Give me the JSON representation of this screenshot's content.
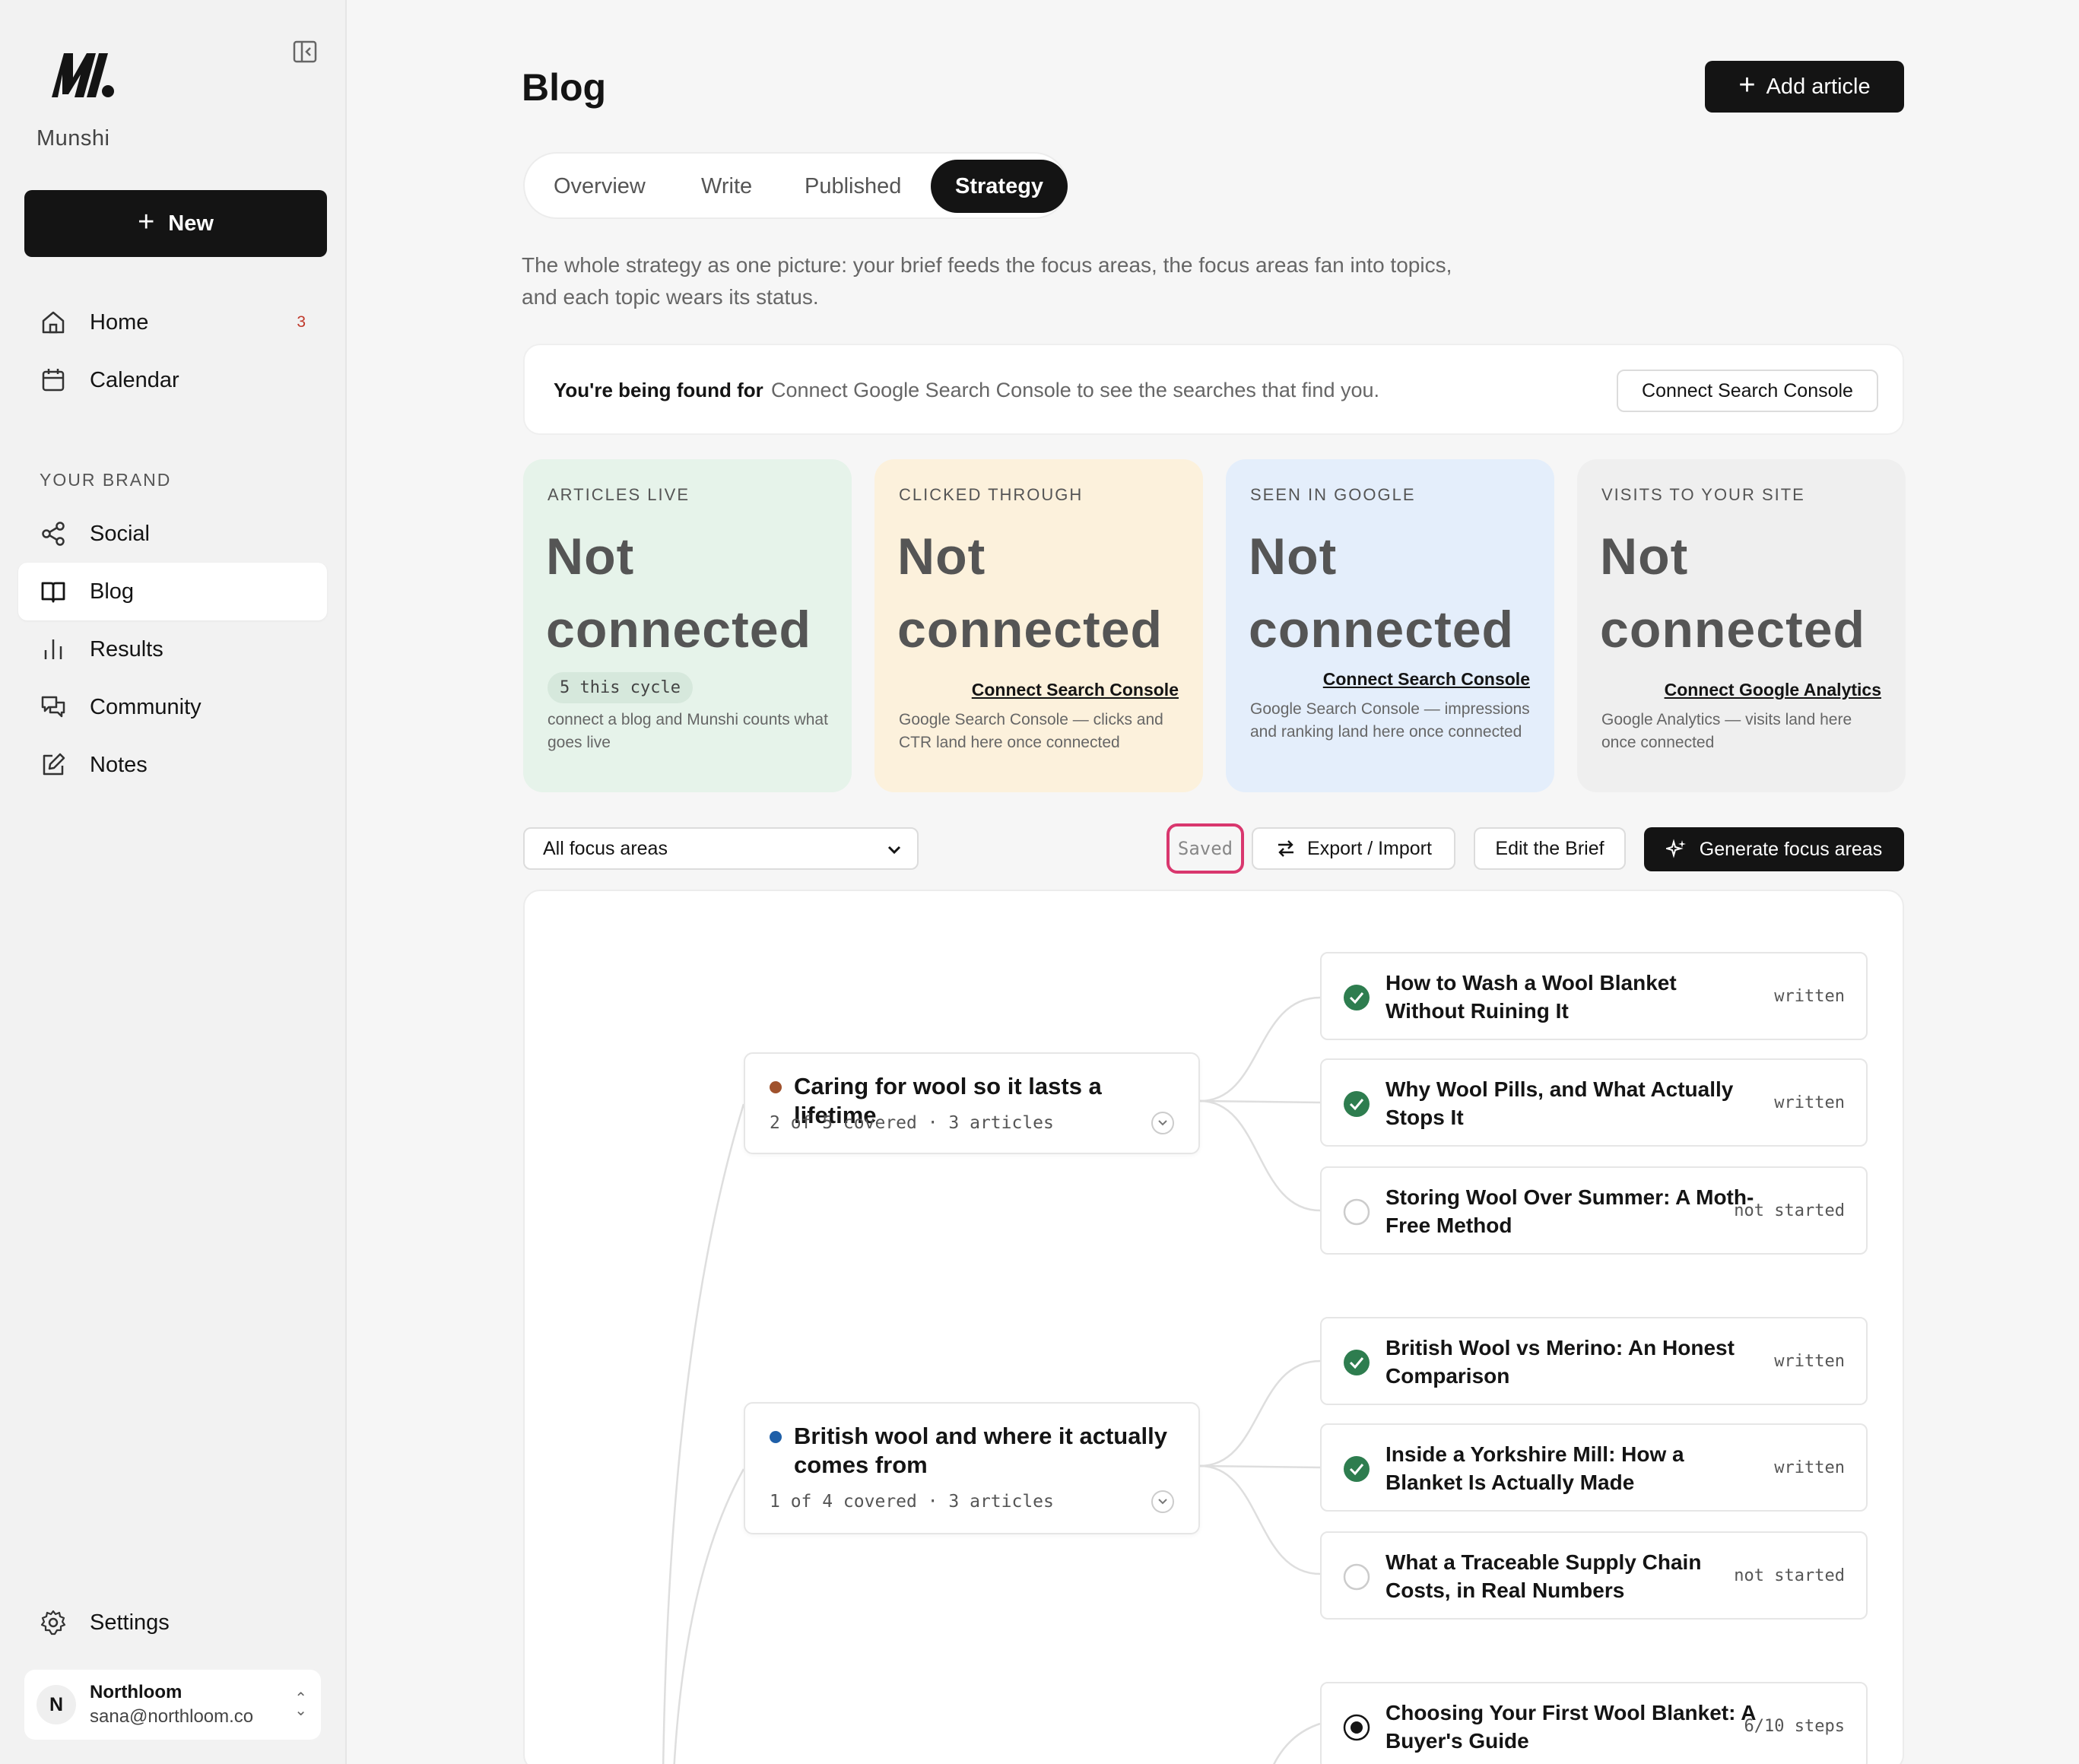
{
  "app": {
    "brand": "Munshi"
  },
  "sidebar": {
    "new_label": "New",
    "items": [
      {
        "label": "Home",
        "badge": "3"
      },
      {
        "label": "Calendar"
      }
    ],
    "section_label": "YOUR BRAND",
    "brand_items": [
      {
        "label": "Social"
      },
      {
        "label": "Blog",
        "active": true
      },
      {
        "label": "Results"
      },
      {
        "label": "Community"
      },
      {
        "label": "Notes"
      }
    ],
    "settings_label": "Settings",
    "account": {
      "initial": "N",
      "name": "Northloom",
      "email": "sana@northloom.co"
    }
  },
  "header": {
    "title": "Blog",
    "add_label": "Add article"
  },
  "tabs": [
    {
      "label": "Overview"
    },
    {
      "label": "Write"
    },
    {
      "label": "Published"
    },
    {
      "label": "Strategy",
      "active": true
    }
  ],
  "intro": "The whole strategy as one picture: your brief feeds the focus areas, the focus areas fan into topics, and each topic wears its status.",
  "found": {
    "label": "You're being found for",
    "text": "Connect Google Search Console to see the searches that find you.",
    "button": "Connect Search Console"
  },
  "stats": [
    {
      "label": "ARTICLES LIVE",
      "value_1": "Not",
      "value_2": "connected",
      "pill": "5 this cycle",
      "note": "connect a blog and Munshi counts what goes live",
      "color": "#e6f3ea"
    },
    {
      "label": "CLICKED THROUGH",
      "value_1": "Not",
      "value_2": "connected",
      "link": "Connect Search Console",
      "note": "Google Search Console — clicks and CTR land here once connected",
      "color": "#fcf1dc"
    },
    {
      "label": "SEEN IN GOOGLE",
      "value_1": "Not",
      "value_2": "connected",
      "link": "Connect Search Console",
      "note": "Google Search Console — impressions and ranking land here once connected",
      "color": "#e4eefb"
    },
    {
      "label": "VISITS TO YOUR SITE",
      "value_1": "Not",
      "value_2": "connected",
      "link": "Connect Google Analytics",
      "note": "Google Analytics — visits land here once connected",
      "color": "#efefef"
    }
  ],
  "toolbar": {
    "filter_value": "All focus areas",
    "saved": "Saved",
    "export_label": "Export / Import",
    "edit_brief_label": "Edit the Brief",
    "generate_label": "Generate focus areas"
  },
  "focus_areas": [
    {
      "title": "Caring for wool so it lasts a lifetime",
      "meta": "2 of 5 covered · 3 articles",
      "color": "#a0522d"
    },
    {
      "title": "British wool and where it actually comes from",
      "meta": "1 of 4 covered · 3 articles",
      "color": "#1f5fa8"
    }
  ],
  "topics": [
    {
      "title": "How to Wash a Wool Blanket Without Ruining It",
      "status": "written"
    },
    {
      "title": "Why Wool Pills, and What Actually Stops It",
      "status": "written"
    },
    {
      "title": "Storing Wool Over Summer: A Moth-Free Method",
      "status": "not started"
    },
    {
      "title": "British Wool vs Merino: An Honest Comparison",
      "status": "written"
    },
    {
      "title": "Inside a Yorkshire Mill: How a Blanket Is Actually Made",
      "status": "written"
    },
    {
      "title": "What a Traceable Supply Chain Costs, in Real Numbers",
      "status": "not started"
    },
    {
      "title": "Choosing Your First Wool Blanket: A Buyer's Guide",
      "status": "6/10 steps"
    }
  ],
  "colors": {
    "written": "#2e7d4f",
    "accent_saved": "#d9376e"
  }
}
